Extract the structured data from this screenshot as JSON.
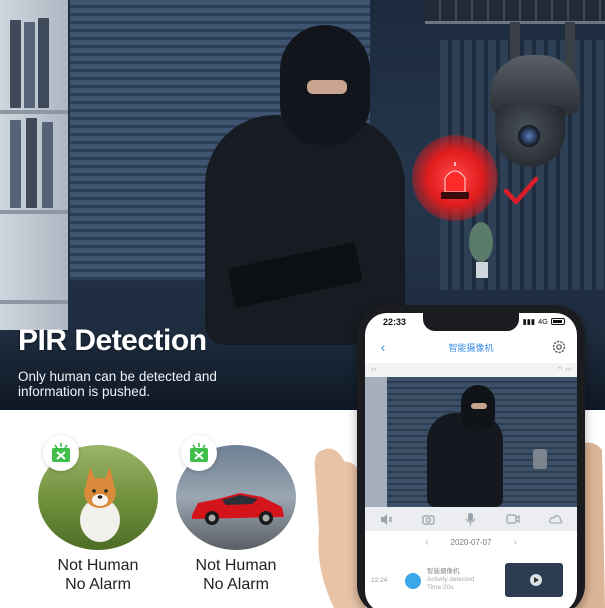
{
  "hero": {
    "title": "PIR Detection",
    "subtitle": "Only human can be detected and information is pushed."
  },
  "cards": [
    {
      "line1": "Not Human",
      "line2": "No Alarm",
      "subject": "dog"
    },
    {
      "line1": "Not Human",
      "line2": "No Alarm",
      "subject": "car"
    }
  ],
  "phone": {
    "status_time": "22:33",
    "network": "4G",
    "app_title": "智能摄像机",
    "date": "2020-07-07",
    "event": {
      "time": "22:24",
      "title": "智能摄像机",
      "description": "Activity detected Time:20s"
    }
  },
  "colors": {
    "accent": "#3a8ee6",
    "alarm_red": "#e11c1c",
    "check_red": "#d91e2a",
    "badge_green": "#3fbf4a"
  }
}
